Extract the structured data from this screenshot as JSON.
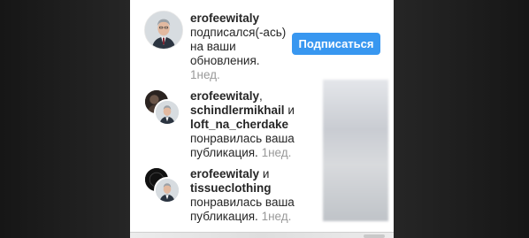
{
  "notifications": [
    {
      "users": [
        "erofeewitaly"
      ],
      "action": "подписался(-ась) на ваши обновления.",
      "time": "1нед.",
      "follow_label": "Подписаться"
    },
    {
      "users": [
        "erofeewitaly",
        "schindlermikhail",
        "loft_na_cherdake"
      ],
      "joiner": "и",
      "action": "понравилась ваша публикация.",
      "time": "1нед."
    },
    {
      "users": [
        "erofeewitaly",
        "tissueclothing"
      ],
      "joiner": "и",
      "action": "понравилась ваша публикация.",
      "time": "1нед."
    }
  ]
}
